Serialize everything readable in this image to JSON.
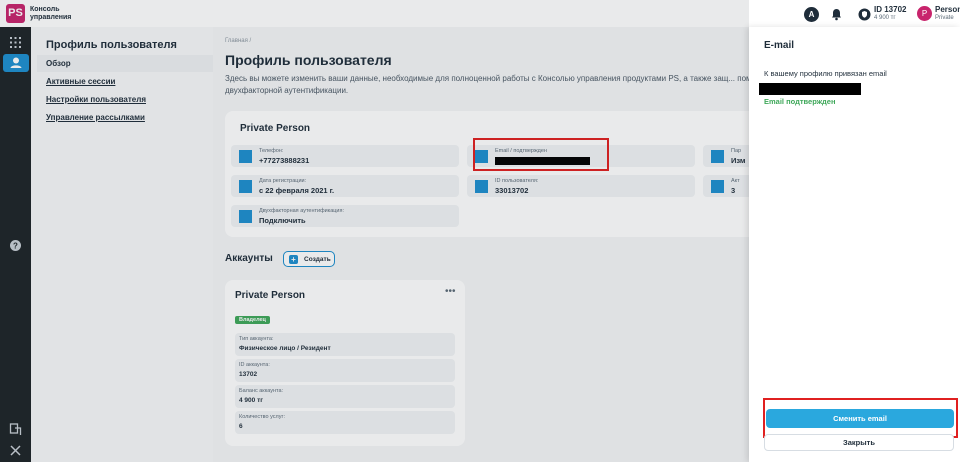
{
  "topbar": {
    "logo_text": "PS",
    "app_name_line1": "Консоль",
    "app_name_line2": "управления",
    "avatar_letter": "A",
    "account_id": "ID 13702",
    "balance": "4 900 тг",
    "user_initial": "P",
    "user_name": "Person",
    "user_role": "Private"
  },
  "subnav": {
    "heading": "Профиль пользователя",
    "items": [
      {
        "label": "Обзор"
      },
      {
        "label": "Активные сессии"
      },
      {
        "label": "Настройки пользователя"
      },
      {
        "label": "Управление рассылками"
      }
    ]
  },
  "main": {
    "breadcrumb": "Главная  /",
    "title": "Профиль пользователя",
    "description": "Здесь вы можете изменить ваши данные, необходимые для полноценной работы с Консолью управления продуктами PS, а также защ... помощью двухфакторной аутентификации.",
    "profile_card": {
      "title": "Private Person",
      "fields": [
        {
          "label": "Телефон:",
          "value": "+77273888231"
        },
        {
          "label": "Email / подтвержден",
          "value": ""
        },
        {
          "label": "Пар",
          "value": "Изм"
        },
        {
          "label": "Дата регистрации:",
          "value": "с 22 февраля 2021 г."
        },
        {
          "label": "ID пользователя:",
          "value": "33013702"
        },
        {
          "label": "Акт",
          "value": "3"
        },
        {
          "label": "Двухфакторная аутентификация:",
          "value": "Подключить"
        }
      ]
    },
    "accounts": {
      "heading": "Аккаунты",
      "create_label": "Создать",
      "card": {
        "name": "Private Person",
        "menu": "•••",
        "badge": "Владелец",
        "rows": [
          {
            "label": "Тип аккаунта:",
            "value": "Физическое лицо / Резидент"
          },
          {
            "label": "ID аккаунта:",
            "value": "13702"
          },
          {
            "label": "Баланс аккаунта:",
            "value": "4 900 тг"
          },
          {
            "label": "Количество услуг:",
            "value": "6"
          }
        ]
      }
    }
  },
  "panel": {
    "title": "E-mail",
    "text": "К вашему профилю привязан email",
    "verified": "Email подтвержден",
    "change_button": "Сменить email",
    "close_button": "Закрыть"
  },
  "colors": {
    "brand": "#c8246c",
    "accent": "#1e8fd0",
    "primary_button": "#2aa8de",
    "success": "#3fa85a",
    "highlight": "#e02020"
  }
}
